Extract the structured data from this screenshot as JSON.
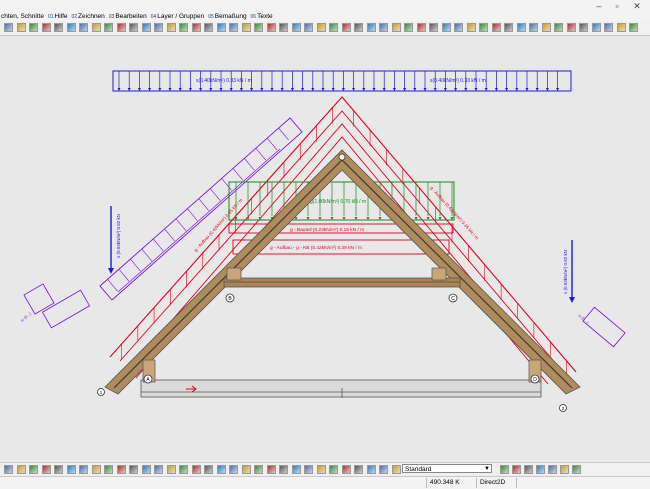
{
  "menu": {
    "items": [
      {
        "key": "",
        "label": "chten, Schnitte"
      },
      {
        "key": "01",
        "label": "Hilfe"
      },
      {
        "key": "02",
        "label": "Zeichnen"
      },
      {
        "key": "03",
        "label": "Bearbeiten"
      },
      {
        "key": "04",
        "label": "Layer / Gruppen"
      },
      {
        "key": "05",
        "label": "Bemaßung"
      },
      {
        "key": "06",
        "label": "Texte"
      }
    ]
  },
  "drawing": {
    "loads": {
      "top_left": "s(0.40kN/m²) 0.33 kN / m",
      "top_right": "s(0.40kN/m²) 0.33 kN / m",
      "left_vertical": "s (0.93kN/m²) 0.82 kN",
      "right_vertical": "s (0.93kN/m²) 0.82 kN",
      "left_wind": "w (0...)",
      "right_wind": "w (0...)",
      "green": "g(1.00kN/m²) 0.70 kN / m",
      "bauteil": "g - Bauteil (0.23kN/m²) 0.16 kN / m",
      "aufbau": "g - Aufbau - g - KB (0.42kN/m²) 0.29 kN / m",
      "slope_left": "g - Aufbau (0.42kN/m²) 0.35 kN / m",
      "slope_right": "g - Aufbau (0.42kN/m²) 0.35 kN / m"
    },
    "nodes": {
      "A": "A",
      "B": "B",
      "C": "C",
      "D": "D",
      "one": "1",
      "two": "2"
    }
  },
  "layer": {
    "selected": "Standard"
  },
  "status": {
    "coord": "490.348 K",
    "renderer": "Direct2D"
  },
  "colors": {
    "blue": "#1b1bd6",
    "red": "#e0001b",
    "purple": "#7a14d8",
    "green": "#1a8a1a",
    "wood": "#9c7a4e",
    "grey": "#6b6b6b"
  },
  "icons": {
    "toolbar_top": [
      "tool-icon"
    ],
    "toolbar_bottom": [
      "tool-icon"
    ]
  }
}
